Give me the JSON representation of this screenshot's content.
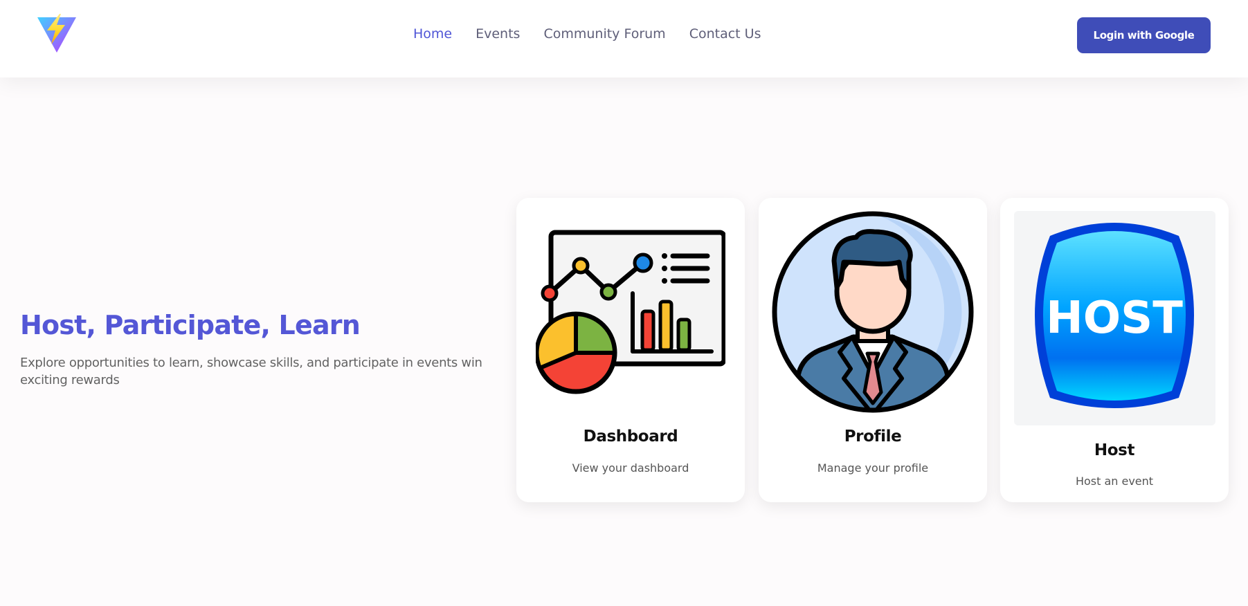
{
  "nav": {
    "logo_icon": "vite-bolt-logo-icon",
    "links": [
      {
        "label": "Home",
        "active": true
      },
      {
        "label": "Events",
        "active": false
      },
      {
        "label": "Community Forum",
        "active": false
      },
      {
        "label": "Contact Us",
        "active": false
      }
    ],
    "login_label": "Login with Google"
  },
  "hero": {
    "title": "Host, Participate, Learn",
    "subtitle": "Explore opportunities to learn, showcase skills, and participate in events win exciting rewards"
  },
  "cards": [
    {
      "title": "Dashboard",
      "description": "View your dashboard",
      "icon": "dashboard-chart-icon"
    },
    {
      "title": "Profile",
      "description": "Manage your profile",
      "icon": "profile-avatar-icon"
    },
    {
      "title": "Host",
      "description": "Host an event",
      "icon": "host-badge-icon"
    }
  ],
  "host_badge_text": "HOST",
  "colors": {
    "accent": "#4f55d6",
    "button": "#3f4db8",
    "background": "#fdfbfc",
    "text_muted": "#5e5e78"
  }
}
